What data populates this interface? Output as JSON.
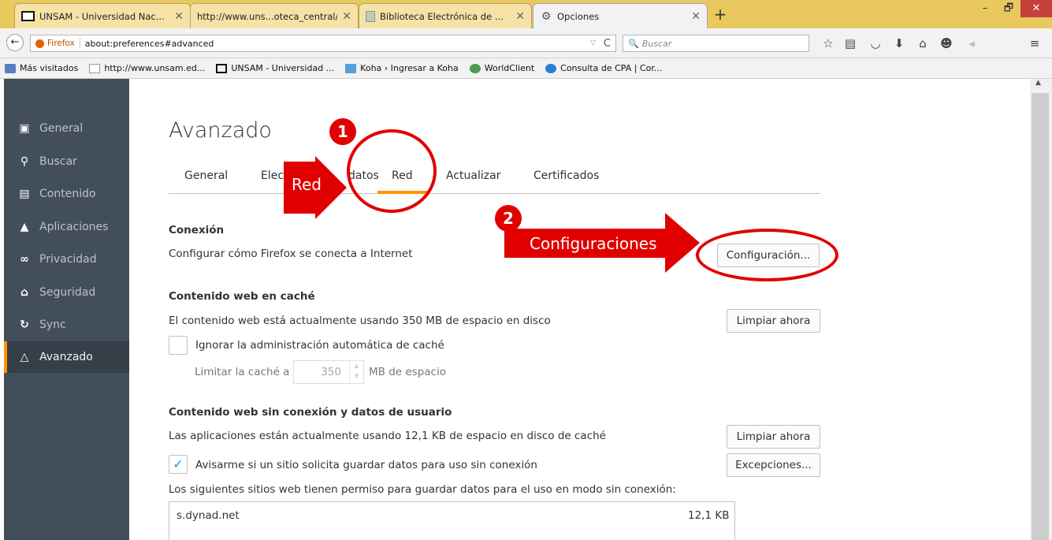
{
  "browser": {
    "tabs": [
      {
        "title": "UNSAM - Universidad Nac...",
        "icon": "unsam-favicon"
      },
      {
        "title": "http://www.uns...oteca_central/",
        "icon": "none"
      },
      {
        "title": "Biblioteca Electrónica de ...",
        "icon": "book-favicon"
      },
      {
        "title": "Opciones",
        "icon": "gear-icon"
      }
    ],
    "new_tab": "+",
    "window_controls": {
      "minimize": "–",
      "maximize": "🗗",
      "close": "✕"
    },
    "identity_label": "Firefox",
    "url": "about:preferences#advanced",
    "search_placeholder": "Buscar",
    "bookmarks": [
      {
        "label": "Más visitados",
        "icon": "blue"
      },
      {
        "label": "http://www.unsam.ed...",
        "icon": "page"
      },
      {
        "label": "UNSAM - Universidad ...",
        "icon": "unsam"
      },
      {
        "label": "Koha › Ingresar a Koha",
        "icon": "koha"
      },
      {
        "label": "WorldClient",
        "icon": "world"
      },
      {
        "label": "Consulta de CPA | Cor...",
        "icon": "cpa"
      }
    ]
  },
  "sidebar": {
    "items": [
      {
        "label": "General",
        "icon": "general-icon"
      },
      {
        "label": "Buscar",
        "icon": "search-icon"
      },
      {
        "label": "Contenido",
        "icon": "document-icon"
      },
      {
        "label": "Aplicaciones",
        "icon": "rocket-icon"
      },
      {
        "label": "Privacidad",
        "icon": "mask-icon"
      },
      {
        "label": "Seguridad",
        "icon": "lock-icon"
      },
      {
        "label": "Sync",
        "icon": "sync-icon"
      },
      {
        "label": "Avanzado",
        "icon": "wizard-icon"
      }
    ],
    "selected": "Avanzado"
  },
  "main": {
    "heading": "Avanzado",
    "subtabs": [
      "General",
      "Elecc",
      "datos",
      "Red",
      "Actualizar",
      "Certificados"
    ],
    "selected_subtab": "Red",
    "connection": {
      "title": "Conexión",
      "description": "Configurar cómo Firefox se conecta a Internet",
      "button": "Configuración..."
    },
    "cache": {
      "title": "Contenido web en caché",
      "description": "El contenido web está actualmente usando 350 MB de espacio en disco",
      "button": "Limpiar ahora",
      "override_label": "Ignorar la administración automática de caché",
      "override_checked": false,
      "limit_label": "Limitar la caché a",
      "limit_value": "350",
      "limit_unit": "MB de espacio"
    },
    "offline": {
      "title": "Contenido web sin conexión y datos de usuario",
      "description": "Las aplicaciones están actualmente usando 12,1 KB de espacio en disco de caché",
      "clear_button": "Limpiar ahora",
      "notify_label": "Avisarme si un sitio solicita guardar datos para uso sin conexión",
      "notify_checked": true,
      "exceptions_button": "Excepciones...",
      "list_caption": "Los siguientes sitios web tienen permiso para guardar datos para el uso en modo sin conexión:",
      "sites": [
        {
          "host": "s.dynad.net",
          "size": "12,1 KB"
        }
      ]
    }
  },
  "annotations": {
    "step1": {
      "number": "1",
      "label": "Red"
    },
    "step2": {
      "number": "2",
      "label": "Configuraciones"
    },
    "color": "#e10000"
  }
}
